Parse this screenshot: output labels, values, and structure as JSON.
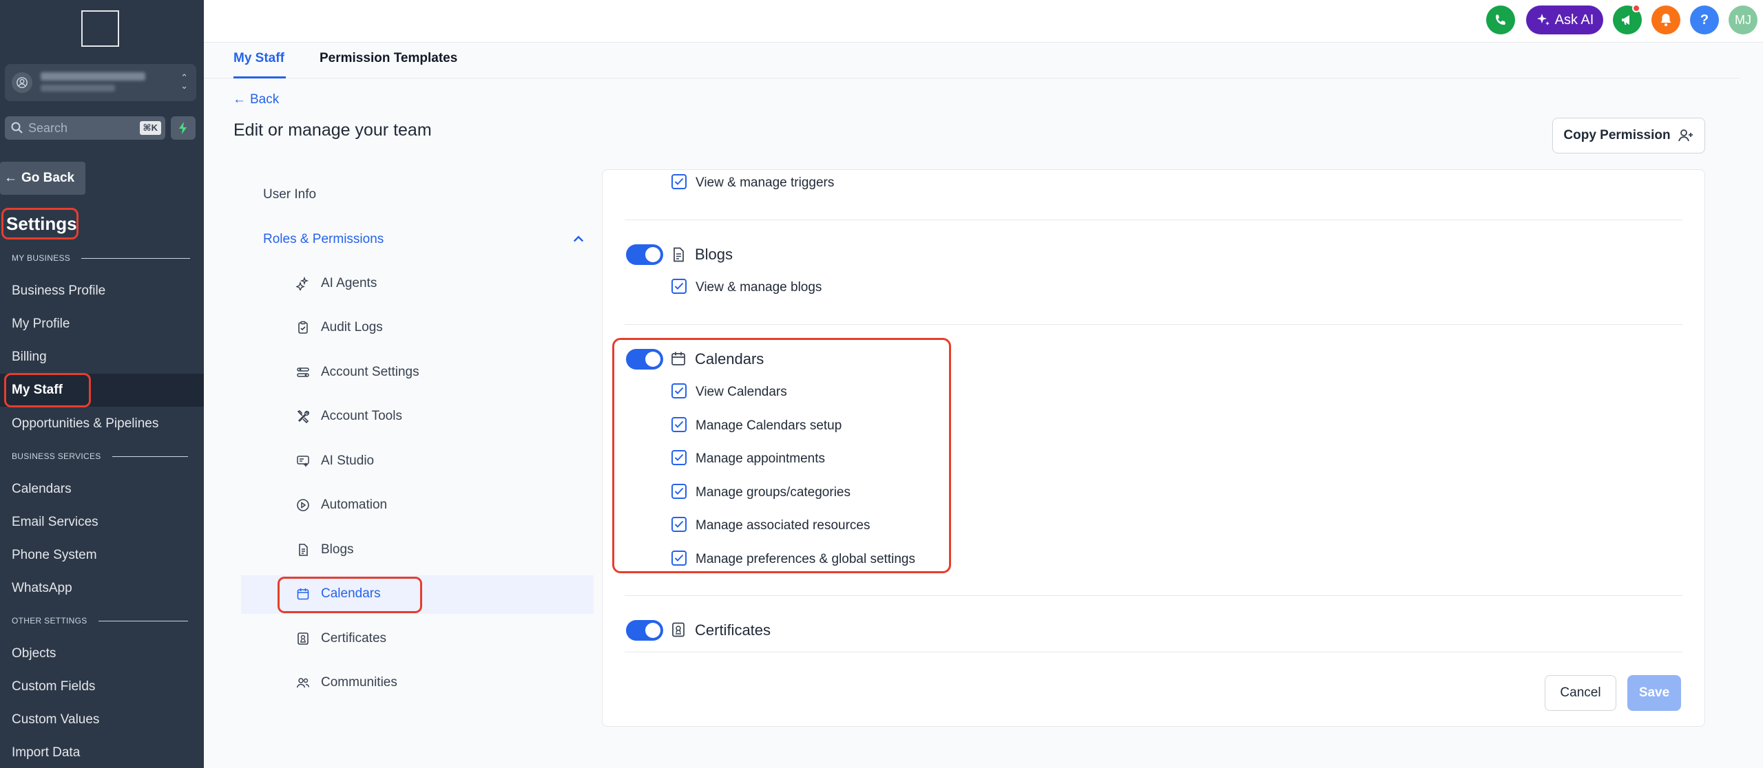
{
  "sidebar": {
    "search_placeholder": "Search",
    "search_shortcut": "⌘K",
    "go_back": "Go Back",
    "title": "Settings",
    "section_my_business": "MY BUSINESS",
    "section_business_services": "BUSINESS SERVICES",
    "section_other_settings": "OTHER SETTINGS",
    "items": {
      "business_profile": "Business Profile",
      "my_profile": "My Profile",
      "billing": "Billing",
      "my_staff": "My Staff",
      "opportunities": "Opportunities & Pipelines",
      "calendars": "Calendars",
      "email_services": "Email Services",
      "phone_system": "Phone System",
      "whatsapp": "WhatsApp",
      "objects": "Objects",
      "custom_fields": "Custom Fields",
      "custom_values": "Custom Values",
      "import_data": "Import Data"
    }
  },
  "topbar": {
    "ask_ai": "Ask AI",
    "help": "?",
    "avatar_initials": "MJ"
  },
  "tabs": {
    "my_staff": "My Staff",
    "permission_templates": "Permission Templates"
  },
  "page": {
    "back": "Back",
    "title": "Edit or manage your team",
    "copy_permission": "Copy Permission"
  },
  "menu": {
    "user_info": "User Info",
    "roles_permissions": "Roles & Permissions",
    "ai_agents": "AI Agents",
    "audit_logs": "Audit Logs",
    "account_settings": "Account Settings",
    "account_tools": "Account Tools",
    "ai_studio": "AI Studio",
    "automation": "Automation",
    "blogs": "Blogs",
    "calendars": "Calendars",
    "certificates": "Certificates",
    "communities": "Communities"
  },
  "permissions": {
    "triggers": "View & manage triggers",
    "blogs_title": "Blogs",
    "blogs_manage": "View & manage blogs",
    "calendars_title": "Calendars",
    "cal_view": "View Calendars",
    "cal_setup": "Manage Calendars setup",
    "cal_appointments": "Manage appointments",
    "cal_groups": "Manage groups/categories",
    "cal_resources": "Manage associated resources",
    "cal_preferences": "Manage preferences & global settings",
    "certificates_title": "Certificates"
  },
  "actions": {
    "cancel": "Cancel",
    "save": "Save"
  },
  "colors": {
    "accent": "#2563eb",
    "highlight": "#e53e2e",
    "sidebar_bg": "#2c3848"
  }
}
